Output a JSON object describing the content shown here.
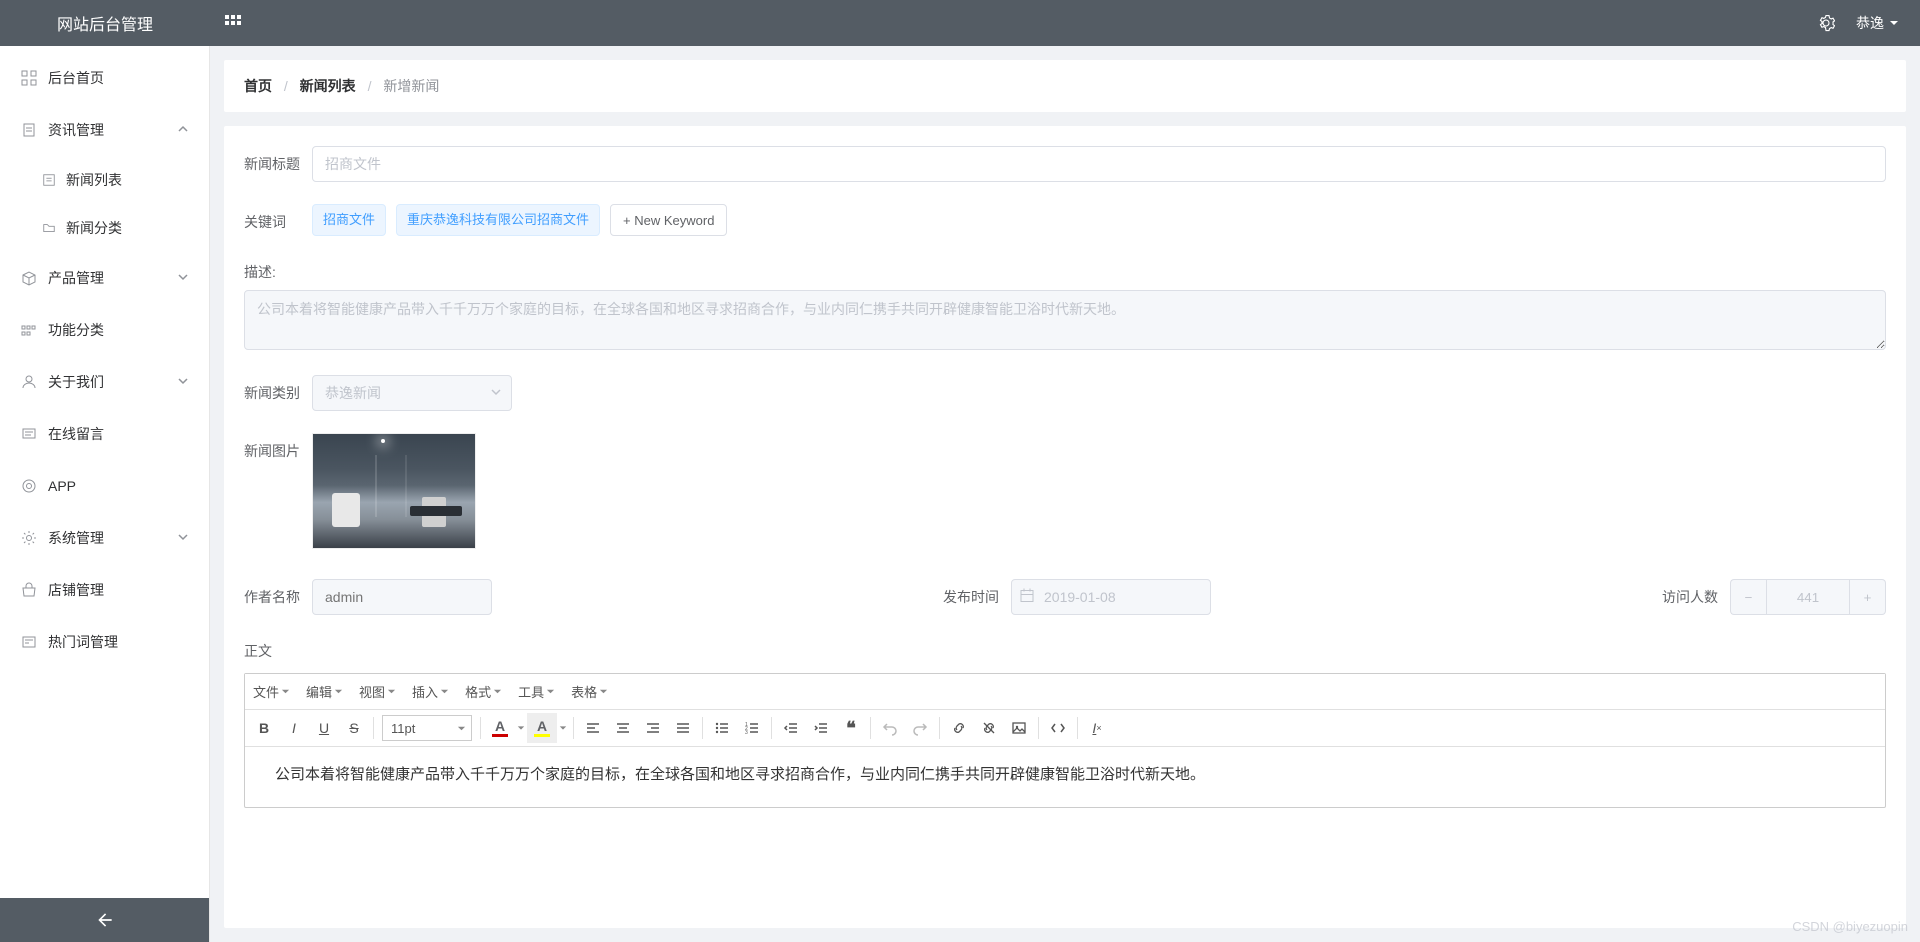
{
  "header": {
    "logo": "网站后台管理",
    "user": "恭逸"
  },
  "sidebar": {
    "items": [
      {
        "label": "后台首页",
        "icon": "grid-icon",
        "expandable": false
      },
      {
        "label": "资讯管理",
        "icon": "clipboard-icon",
        "expandable": true,
        "expanded": true,
        "children": [
          {
            "label": "新闻列表",
            "icon": "list-icon"
          },
          {
            "label": "新闻分类",
            "icon": "category-icon"
          }
        ]
      },
      {
        "label": "产品管理",
        "icon": "box-icon",
        "expandable": true
      },
      {
        "label": "功能分类",
        "icon": "tiles-icon",
        "expandable": false
      },
      {
        "label": "关于我们",
        "icon": "person-icon",
        "expandable": true
      },
      {
        "label": "在线留言",
        "icon": "message-icon",
        "expandable": false
      },
      {
        "label": "APP",
        "icon": "app-icon",
        "expandable": false
      },
      {
        "label": "系统管理",
        "icon": "gear-icon",
        "expandable": true
      },
      {
        "label": "店铺管理",
        "icon": "shop-icon",
        "expandable": false
      },
      {
        "label": "热门词管理",
        "icon": "tag-icon",
        "expandable": false
      }
    ]
  },
  "breadcrumb": {
    "items": [
      {
        "label": "首页",
        "strong": true
      },
      {
        "label": "新闻列表",
        "strong": true
      },
      {
        "label": "新增新闻",
        "current": true
      }
    ]
  },
  "form": {
    "title_label": "新闻标题",
    "title_placeholder": "招商文件",
    "keywords_label": "关键词",
    "keywords": [
      "招商文件",
      "重庆恭逸科技有限公司招商文件"
    ],
    "new_keyword_btn": "+ New Keyword",
    "desc_label": "描述:",
    "desc_text": "公司本着将智能健康产品带入千千万万个家庭的目标，在全球各国和地区寻求招商合作，与业内同仁携手共同开辟健康智能卫浴时代新天地。",
    "category_label": "新闻类别",
    "category_value": "恭逸新闻",
    "image_label": "新闻图片",
    "author_label": "作者名称",
    "author_value": "admin",
    "publish_label": "发布时间",
    "publish_value": "2019-01-08",
    "views_label": "访问人数",
    "views_value": "441",
    "body_label": "正文"
  },
  "editor": {
    "menus": [
      "文件",
      "编辑",
      "视图",
      "插入",
      "格式",
      "工具",
      "表格"
    ],
    "font_size": "11pt",
    "content": "公司本着将智能健康产品带入千千万万个家庭的目标，在全球各国和地区寻求招商合作，与业内同仁携手共同开辟健康智能卫浴时代新天地。"
  },
  "watermark": "CSDN @biyezuopin"
}
